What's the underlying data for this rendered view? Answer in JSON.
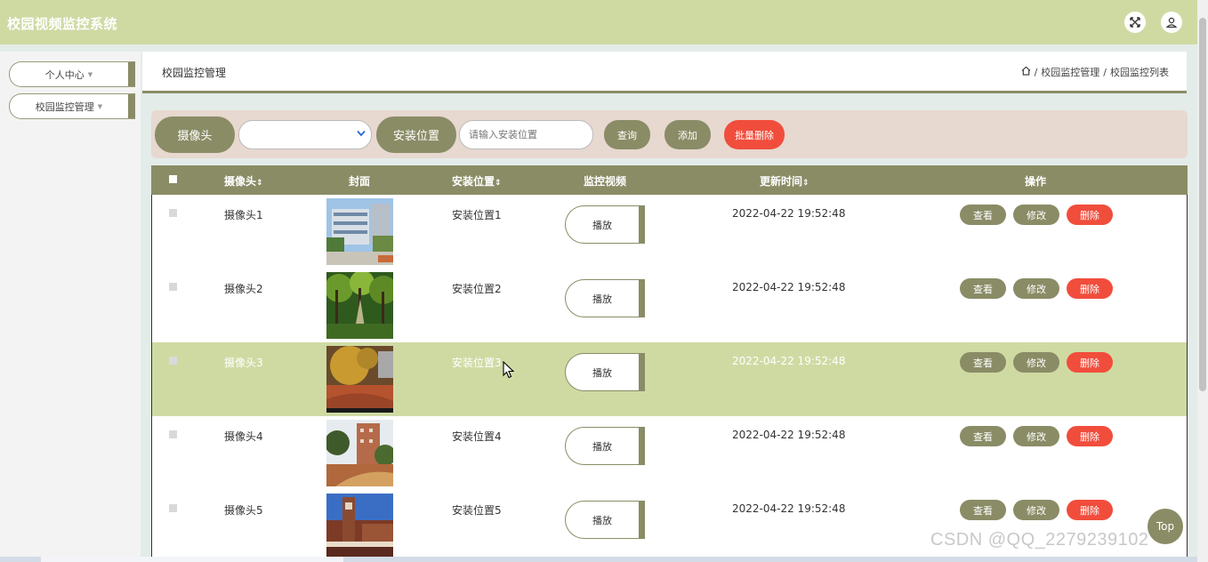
{
  "app": {
    "title": "校园视频监控系统"
  },
  "header_icons": [
    "fullscreen-icon",
    "user-icon"
  ],
  "sidebar": {
    "items": [
      {
        "label": "个人中心"
      },
      {
        "label": "校园监控管理"
      }
    ]
  },
  "content": {
    "title": "校园监控管理",
    "breadcrumb": [
      "校园监控管理",
      "校园监控列表"
    ],
    "breadcrumb_sep": "/"
  },
  "search": {
    "camera_label": "摄像头",
    "camera_value": "",
    "location_label": "安装位置",
    "location_placeholder": "请输入安装位置",
    "query_label": "查询",
    "add_label": "添加",
    "batch_delete_label": "批量删除"
  },
  "table": {
    "headers": {
      "camera": "摄像头",
      "cover": "封面",
      "location": "安装位置",
      "video": "监控视频",
      "updated": "更新时间",
      "actions": "操作"
    },
    "sort_glyph": "⇕",
    "rows": [
      {
        "camera": "摄像头1",
        "location": "安装位置1",
        "updated": "2022-04-22 19:52:48",
        "play": "播放",
        "view": "查看",
        "edit": "修改",
        "delete": "删除"
      },
      {
        "camera": "摄像头2",
        "location": "安装位置2",
        "updated": "2022-04-22 19:52:48",
        "play": "播放",
        "view": "查看",
        "edit": "修改",
        "delete": "删除"
      },
      {
        "camera": "摄像头3",
        "location": "安装位置3",
        "updated": "2022-04-22 19:52:48",
        "play": "播放",
        "view": "查看",
        "edit": "修改",
        "delete": "删除"
      },
      {
        "camera": "摄像头4",
        "location": "安装位置4",
        "updated": "2022-04-22 19:52:48",
        "play": "播放",
        "view": "查看",
        "edit": "修改",
        "delete": "删除"
      },
      {
        "camera": "摄像头5",
        "location": "安装位置5",
        "updated": "2022-04-22 19:52:48",
        "play": "播放",
        "view": "查看",
        "edit": "修改",
        "delete": "删除"
      }
    ]
  },
  "back_to_top": "Top",
  "watermark": "CSDN @QQ_2279239102",
  "colors": {
    "accent": "#8a8c66",
    "header_bg": "#cfdaa3",
    "delete": "#f14d3c",
    "search_bg": "#e7d8d0"
  }
}
